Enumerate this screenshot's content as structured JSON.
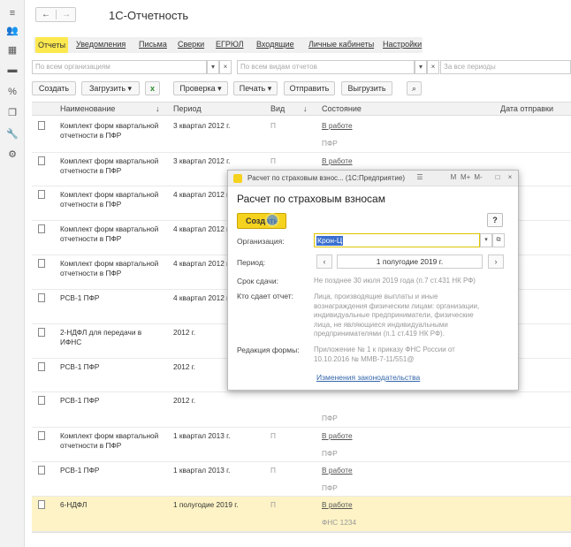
{
  "sidebar": {
    "icons": [
      "menu-icon",
      "people-icon",
      "grid-icon",
      "card-icon",
      "percent-icon",
      "copy-icon",
      "wrench-icon",
      "gear-icon"
    ],
    "glyphs": [
      "≡",
      "👥",
      "▦",
      "▬",
      "%",
      "❐",
      "🔧",
      "⚙"
    ]
  },
  "nav": {
    "back": "←",
    "forward": "→"
  },
  "app_title": "1С-Отчетность",
  "tabs": [
    "Отчеты",
    "Уведомления",
    "Письма",
    "Сверки",
    "ЕГРЮЛ",
    "Входящие",
    "Личные кабинеты",
    "Настройки"
  ],
  "filters": {
    "org_placeholder": "По всем организациям",
    "kind_placeholder": "По всем видам отчетов",
    "period_placeholder": "За все периоды",
    "dropdown": "▾",
    "clear": "×"
  },
  "toolbar": {
    "create": "Создать",
    "load": "Загрузить",
    "check": "Проверка",
    "print": "Печать",
    "send": "Отправить",
    "upload": "Выгрузить",
    "excel_icon": "x",
    "clip_icon": "⌕"
  },
  "grid": {
    "headers": {
      "name": "Наименование",
      "period": "Период",
      "kind": "Вид",
      "state": "Состояние",
      "date": "Дата отправки",
      "sort": "↓"
    },
    "rows": [
      {
        "name_1": "Комплект форм квартальной",
        "name_2": "отчетности в ПФР",
        "period": "3 квартал 2012 г.",
        "kind": "П",
        "status": "В работе",
        "sub": "ПФР"
      },
      {
        "name_1": "Комплект форм квартальной",
        "name_2": "отчетности в ПФР",
        "period": "3 квартал 2012 г.",
        "kind": "П",
        "status": "В работе",
        "sub": ""
      },
      {
        "name_1": "Комплект форм квартальной",
        "name_2": "отчетности в ПФР",
        "period": "4 квартал 2012 г.",
        "kind": "",
        "status": "",
        "sub": ""
      },
      {
        "name_1": "Комплект форм квартальной",
        "name_2": "отчетности в ПФР",
        "period": "4 квартал 2012 г.",
        "kind": "",
        "status": "",
        "sub": ""
      },
      {
        "name_1": "Комплект форм квартальной",
        "name_2": "отчетности в ПФР",
        "period": "4 квартал 2012 г.",
        "kind": "",
        "status": "",
        "sub": ""
      },
      {
        "name_1": "РСВ-1 ПФР",
        "name_2": "",
        "period": "4 квартал 2012 г.",
        "kind": "",
        "status": "",
        "sub": ""
      },
      {
        "name_1": "2-НДФЛ для передачи в",
        "name_2": "ИФНС",
        "period": "2012 г.",
        "kind": "",
        "status": "",
        "sub": ""
      },
      {
        "name_1": "РСВ-1 ПФР",
        "name_2": "",
        "period": "2012 г.",
        "kind": "",
        "status": "",
        "sub": ""
      },
      {
        "name_1": "РСВ-1 ПФР",
        "name_2": "",
        "period": "2012 г.",
        "kind": "",
        "status": "",
        "sub": "ПФР"
      },
      {
        "name_1": "Комплект форм квартальной",
        "name_2": "отчетности в ПФР",
        "period": "1 квартал 2013 г.",
        "kind": "П",
        "status": "В работе",
        "sub": "ПФР"
      },
      {
        "name_1": "РСВ-1 ПФР",
        "name_2": "",
        "period": "1 квартал 2013 г.",
        "kind": "П",
        "status": "В работе",
        "sub": "ПФР"
      },
      {
        "name_1": "6-НДФЛ",
        "name_2": "",
        "period": "1 полугодие 2019 г.",
        "kind": "П",
        "status": "В работе",
        "sub": "ФНС 1234"
      }
    ]
  },
  "dialog": {
    "window_title": "Расчет по страховым взнос... (1С:Предприятие)",
    "title": "Расчет по страховым взносам",
    "create": "Создать",
    "help": "?",
    "org_label": "Организация:",
    "org_value": "Крон-Ц",
    "period_label": "Период:",
    "period_value": "1 полугодие 2019 г.",
    "prev": "‹",
    "next": "›",
    "deadline_label": "Срок сдачи:",
    "deadline_value": "Не позднее 30 июля 2019 года (п.7 ст.431 НК РФ)",
    "who_label": "Кто сдает отчет:",
    "who_lines": [
      "Лица, производящие выплаты и иные",
      "вознаграждения физическим лицам: организации,",
      "индивидуальные предприниматели, физические",
      "лица, не являющиеся индивидуальными",
      "предпринимателями (п.1 ст.419 НК РФ)."
    ],
    "edition_label": "Редакция формы:",
    "edition_lines": [
      "Приложение № 1 к приказу ФНС России от",
      "10.10.2016 № ММВ-7-11/551@"
    ],
    "link": "Изменения законодательства",
    "winbtns": [
      "☰",
      "M",
      "M+",
      "M-",
      "□",
      "×"
    ]
  }
}
